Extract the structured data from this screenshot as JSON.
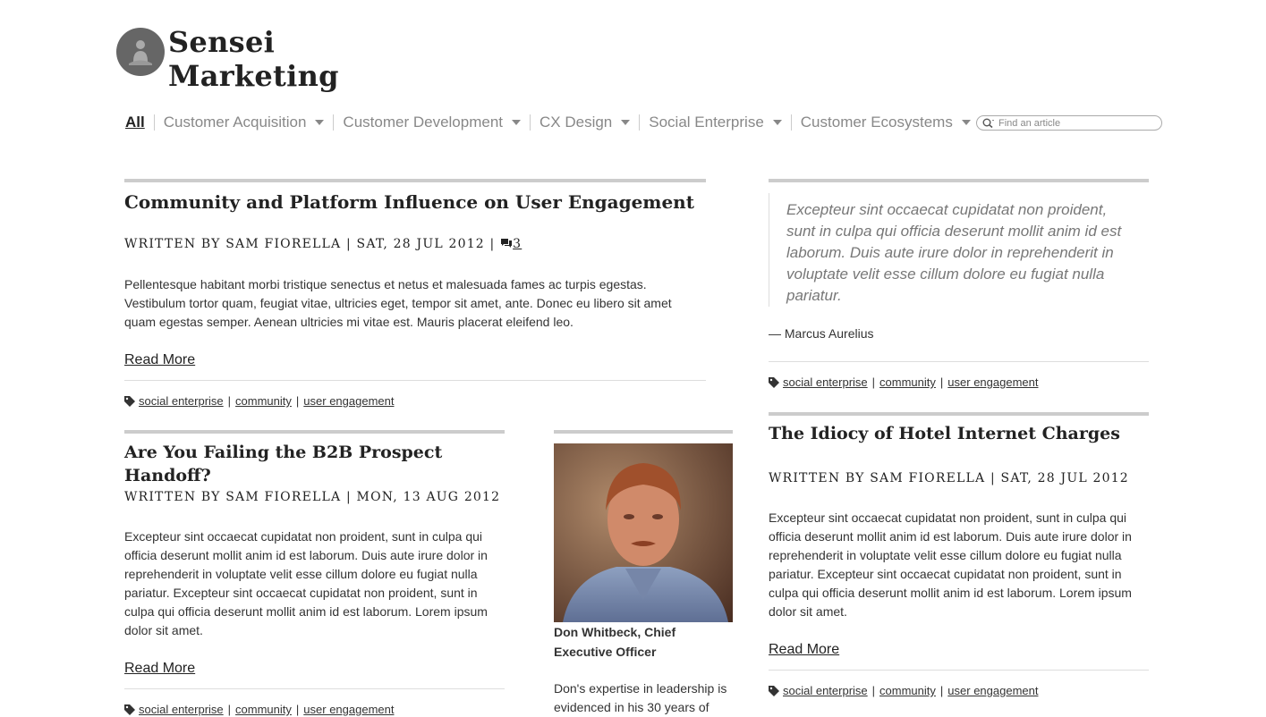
{
  "brand": {
    "line1": "Sensei",
    "line2": "Marketing"
  },
  "nav": {
    "all": "All",
    "items": [
      "Customer Acquisition",
      "Customer Development",
      "CX Design",
      "Social Enterprise",
      "Customer Ecosystems"
    ]
  },
  "search": {
    "placeholder": "Find an article"
  },
  "article1": {
    "title": "Community and Platform Influence on User Engagement",
    "byline": "Written by Sam Fiorella | Sat, 28 Jul 2012 |",
    "comments": "3",
    "excerpt": "Pellentesque habitant morbi tristique senectus et netus et malesuada fames ac turpis egestas. Vestibulum tortor quam, feugiat vitae, ultricies eget, tempor sit amet, ante. Donec eu libero sit amet quam egestas semper. Aenean ultricies mi vitae est. Mauris placerat eleifend leo.",
    "read_more": "Read More",
    "tags": [
      "social enterprise",
      "community",
      "user engagement"
    ]
  },
  "article2": {
    "title": "Are You Failing the B2B Prospect Handoff?",
    "byline": "Written by Sam Fiorella | Mon, 13 Aug 2012",
    "excerpt": "Excepteur sint occaecat cupidatat non proident, sunt in culpa qui officia deserunt mollit anim id est laborum. Duis aute irure dolor in reprehenderit in voluptate velit esse cillum dolore eu fugiat nulla pariatur. Excepteur sint occaecat cupidatat non proident, sunt in culpa qui officia deserunt mollit anim id est laborum. Lorem ipsum dolor sit amet.",
    "read_more": "Read More",
    "tags": [
      "social enterprise",
      "community",
      "user engagement"
    ]
  },
  "profile": {
    "caption": "Don Whitbeck, Chief Executive Officer",
    "bio": "Don's expertise in leadership is evidenced in his 30 years of"
  },
  "quote_card": {
    "quote": "Excepteur sint occaecat cupidatat non proident, sunt in culpa qui officia deserunt mollit anim id est laborum. Duis aute irure dolor in reprehenderit in voluptate velit esse cillum dolore eu fugiat nulla pariatur.",
    "cite": "— Marcus Aurelius",
    "tags": [
      "social enterprise",
      "community",
      "user engagement"
    ]
  },
  "article3": {
    "title": "The Idiocy of Hotel Internet Charges",
    "byline": "Written by Sam Fiorella | Sat, 28 Jul 2012",
    "excerpt": "Excepteur sint occaecat cupidatat non proident, sunt in culpa qui officia deserunt mollit anim id est laborum. Duis aute irure dolor in reprehenderit in voluptate velit esse cillum dolore eu fugiat nulla pariatur. Excepteur sint occaecat cupidatat non proident, sunt in culpa qui officia deserunt mollit anim id est laborum. Lorem ipsum dolor sit amet.",
    "read_more": "Read More",
    "tags": [
      "social enterprise",
      "community",
      "user engagement"
    ]
  }
}
